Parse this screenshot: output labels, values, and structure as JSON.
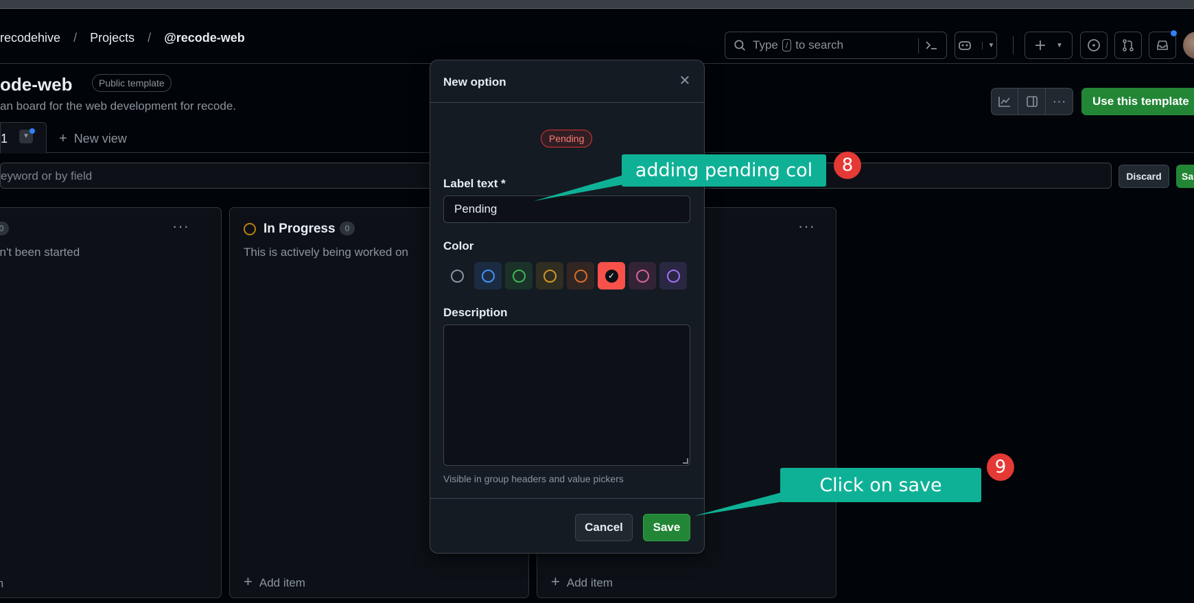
{
  "header": {
    "breadcrumb": [
      "recodehive",
      "Projects",
      "@recode-web"
    ],
    "breadcrumb_separator": "/",
    "search_prefix": "Type",
    "search_key": "/",
    "search_suffix": "to search"
  },
  "project": {
    "title": "ode-web",
    "badge": "Public template",
    "description": "an board for the web development for recode.",
    "use_template_button": "Use this template"
  },
  "tabs": {
    "active_tab_label": "1",
    "new_view_label": "New view"
  },
  "filter": {
    "placeholder": "eyword or by field",
    "discard_label": "Discard",
    "save_label": "Sa"
  },
  "columns": [
    {
      "title": "",
      "count": "0",
      "description": "sn't been started",
      "add_item": "m"
    },
    {
      "title": "In Progress",
      "count": "0",
      "description": "This is actively being worked on",
      "add_item": "Add item"
    },
    {
      "title": "",
      "count": "",
      "description": "",
      "add_item": "Add item"
    }
  ],
  "modal": {
    "title": "New option",
    "preview_label": "Pending",
    "label_text_heading": "Label text *",
    "label_text_value": "Pending",
    "color_heading": "Color",
    "colors": [
      {
        "name": "gray",
        "hex": "#8b949e",
        "selected": false
      },
      {
        "name": "blue",
        "hex": "#4493f8",
        "selected": false
      },
      {
        "name": "green",
        "hex": "#3fb950",
        "selected": false
      },
      {
        "name": "yellow",
        "hex": "#d29922",
        "selected": false
      },
      {
        "name": "orange",
        "hex": "#db6d28",
        "selected": false
      },
      {
        "name": "red",
        "hex": "#f85149",
        "selected": true
      },
      {
        "name": "pink",
        "hex": "#db61a2",
        "selected": false
      },
      {
        "name": "purple",
        "hex": "#a371f7",
        "selected": false
      }
    ],
    "description_heading": "Description",
    "description_value": "",
    "hint": "Visible in group headers and value pickers",
    "cancel_label": "Cancel",
    "save_label": "Save"
  },
  "annotations": [
    {
      "step": "8",
      "text": "adding pending col"
    },
    {
      "step": "9",
      "text": "Click on save"
    }
  ]
}
